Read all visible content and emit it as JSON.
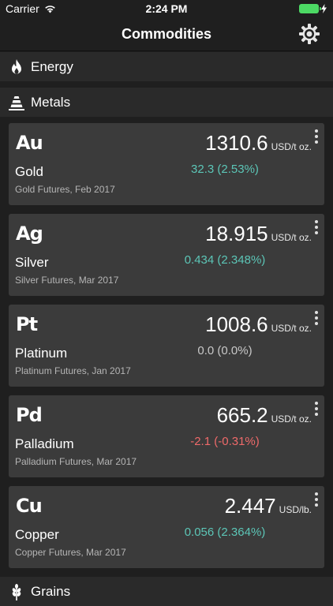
{
  "status": {
    "carrier": "Carrier",
    "time": "2:24 PM"
  },
  "nav": {
    "title": "Commodities"
  },
  "sections": {
    "energy": "Energy",
    "metals": "Metals",
    "grains": "Grains"
  },
  "cards": [
    {
      "symbol": "Au",
      "name": "Gold",
      "contract": "Gold Futures, Feb 2017",
      "price": "1310.6",
      "unit": "USD/t oz.",
      "change": "32.3 (2.53%)",
      "trend": "up"
    },
    {
      "symbol": "Ag",
      "name": "Silver",
      "contract": "Silver Futures, Mar 2017",
      "price": "18.915",
      "unit": "USD/t oz.",
      "change": "0.434 (2.348%)",
      "trend": "up"
    },
    {
      "symbol": "Pt",
      "name": "Platinum",
      "contract": "Platinum Futures, Jan 2017",
      "price": "1008.6",
      "unit": "USD/t oz.",
      "change": "0.0 (0.0%)",
      "trend": "flat"
    },
    {
      "symbol": "Pd",
      "name": "Palladium",
      "contract": "Palladium Futures, Mar 2017",
      "price": "665.2",
      "unit": "USD/t oz.",
      "change": "-2.1 (-0.31%)",
      "trend": "down"
    },
    {
      "symbol": "Cu",
      "name": "Copper",
      "contract": "Copper Futures, Mar 2017",
      "price": "2.447",
      "unit": "USD/lb.",
      "change": "0.056 (2.364%)",
      "trend": "up"
    }
  ],
  "colors": {
    "up": "#5cc6b7",
    "down": "#ef6a6a",
    "flat": "#c8c8c8",
    "battery": "#4cd964"
  },
  "icons": {
    "settings": "gear-icon",
    "energy": "flame-icon",
    "metals": "ingot-stack-icon",
    "grains": "wheat-icon",
    "card_menu": "more-vertical-icon"
  }
}
